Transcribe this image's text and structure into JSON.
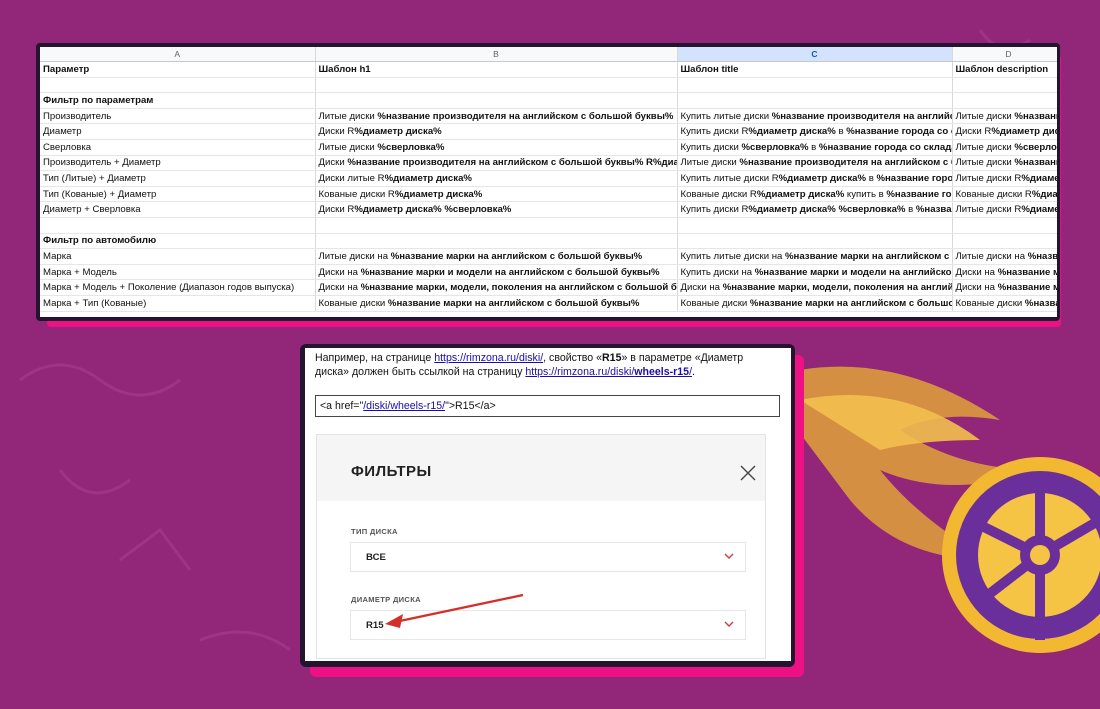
{
  "colors": {
    "background": "#92277a",
    "accent": "#ee1186",
    "frame": "#241430",
    "selected_column": "#d3e3fd",
    "link": "#1a0dab",
    "arrow": "#d4302a"
  },
  "sheet": {
    "columns": [
      "A",
      "B",
      "C",
      "D"
    ],
    "selected_column": "C",
    "header_row": [
      "Параметр",
      "Шаблон h1",
      "Шаблон title",
      "Шаблон description"
    ],
    "sections": [
      {
        "title": "Фильтр по параметрам",
        "rows": [
          {
            "a": "Производитель",
            "b": [
              [
                "Литые диски ",
                false
              ],
              [
                "%название производителя на английском с большой буквы%",
                true
              ]
            ],
            "c": [
              [
                "Купить литые диски ",
                false
              ],
              [
                "%название производителя на английском с большой буквы%",
                true
              ]
            ],
            "d": [
              [
                "Литые диски ",
                false
              ],
              [
                "%название производителя",
                true
              ]
            ]
          },
          {
            "a": "Диаметр",
            "b": [
              [
                "Диски R",
                false
              ],
              [
                "%диаметр диска%",
                true
              ]
            ],
            "c": [
              [
                "Купить диски R",
                false
              ],
              [
                "%диаметр диска%",
                true
              ],
              [
                " в ",
                false
              ],
              [
                "%название города со склада%",
                true
              ]
            ],
            "d": [
              [
                "Диски R",
                false
              ],
              [
                "%диаметр диска%",
                true
              ]
            ]
          },
          {
            "a": "Сверловка",
            "b": [
              [
                "Литые диски ",
                false
              ],
              [
                "%сверловка%",
                true
              ]
            ],
            "c": [
              [
                "Купить диски ",
                false
              ],
              [
                "%сверловка%",
                true
              ],
              [
                " в ",
                false
              ],
              [
                "%название города со склада%",
                true
              ]
            ],
            "d": [
              [
                "Литые диски ",
                false
              ],
              [
                "%сверловка%",
                true
              ]
            ]
          },
          {
            "a": "Производитель + Диаметр",
            "b": [
              [
                "Диски ",
                false
              ],
              [
                "%название производителя на английском с большой буквы% R%диаметр диска%",
                true
              ]
            ],
            "c": [
              [
                "Литые диски ",
                false
              ],
              [
                "%название производителя на английском с большой буквы%",
                true
              ]
            ],
            "d": [
              [
                "Литые диски ",
                false
              ],
              [
                "%название производителя",
                true
              ]
            ]
          },
          {
            "a": "Тип (Литые) + Диаметр",
            "b": [
              [
                "Диски литые R",
                false
              ],
              [
                "%диаметр диска%",
                true
              ]
            ],
            "c": [
              [
                "Купить литые диски R",
                false
              ],
              [
                "%диаметр диска%",
                true
              ],
              [
                " в ",
                false
              ],
              [
                "%название города со склада%",
                true
              ]
            ],
            "d": [
              [
                "Литые диски R",
                false
              ],
              [
                "%диаметр диска%",
                true
              ]
            ]
          },
          {
            "a": "Тип (Кованые) + Диаметр",
            "b": [
              [
                "Кованые диски R",
                false
              ],
              [
                "%диаметр диска%",
                true
              ]
            ],
            "c": [
              [
                "Кованые диски R",
                false
              ],
              [
                "%диаметр диска%",
                true
              ],
              [
                " купить в ",
                false
              ],
              [
                "%название города со склада%",
                true
              ]
            ],
            "d": [
              [
                "Кованые диски R",
                false
              ],
              [
                "%диаметр диска%",
                true
              ]
            ]
          },
          {
            "a": "Диаметр + Сверловка",
            "b": [
              [
                "Диски R",
                false
              ],
              [
                "%диаметр диска% %сверловка%",
                true
              ]
            ],
            "c": [
              [
                "Купить диски R",
                false
              ],
              [
                "%диаметр диска% %сверловка%",
                true
              ],
              [
                " в ",
                false
              ],
              [
                "%название города со склада%",
                true
              ]
            ],
            "d": [
              [
                "Литые диски R",
                false
              ],
              [
                "%диаметр диска%",
                true
              ]
            ]
          }
        ]
      },
      {
        "title": "Фильтр по автомобилю",
        "rows": [
          {
            "a": "Марка",
            "b": [
              [
                "Литые диски на ",
                false
              ],
              [
                "%название марки на английском с большой буквы%",
                true
              ]
            ],
            "c": [
              [
                "Купить литые диски на ",
                false
              ],
              [
                "%название марки на английском с большой буквы%",
                true
              ]
            ],
            "d": [
              [
                "Литые диски на ",
                false
              ],
              [
                "%название марки",
                true
              ]
            ]
          },
          {
            "a": "Марка + Модель",
            "b": [
              [
                "Диски на ",
                false
              ],
              [
                "%название марки и модели на английском с большой буквы%",
                true
              ]
            ],
            "c": [
              [
                "Купить диски на ",
                false
              ],
              [
                "%название марки и модели на английском с большой буквы%",
                true
              ]
            ],
            "d": [
              [
                "Диски на ",
                false
              ],
              [
                "%название марки",
                true
              ]
            ]
          },
          {
            "a": "Марка + Модель + Поколение (Диапазон годов выпуска)",
            "b": [
              [
                "Диски на ",
                false
              ],
              [
                "%название марки, модели, поколения на английском с большой буквы%",
                true
              ]
            ],
            "c": [
              [
                "Диски на ",
                false
              ],
              [
                "%название марки, модели, поколения на английском с большой буквы%",
                true
              ]
            ],
            "d": [
              [
                "Диски на ",
                false
              ],
              [
                "%название марки",
                true
              ]
            ]
          },
          {
            "a": "Марка + Тип (Кованые)",
            "b": [
              [
                "Кованые диски ",
                false
              ],
              [
                "%название марки на английском с большой буквы%",
                true
              ]
            ],
            "c": [
              [
                "Кованые диски ",
                false
              ],
              [
                "%название марки на английском с большой буквы%",
                true
              ]
            ],
            "d": [
              [
                "Кованые диски ",
                false
              ],
              [
                "%название марки",
                true
              ]
            ]
          }
        ]
      }
    ]
  },
  "note": {
    "prefix": "Например, на странице ",
    "link1": "https://rimzona.ru/diski/",
    "mid1": ", свойство «",
    "bold": "R15",
    "mid2": "» в параметре «Диаметр диска» должен быть ссылкой на страницу ",
    "link2_plain": "https://rimzona.ru/diski/",
    "link2_bold": "wheels-r15",
    "link2_tail": "/",
    "suffix": "."
  },
  "code": {
    "open": "<a href=\"",
    "href": "/diski/wheels-r15/",
    "close": "\">R15</a>"
  },
  "filters": {
    "title": "ФИЛЬТРЫ",
    "fields": [
      {
        "label": "ТИП ДИСКА",
        "value": "ВСЕ",
        "icon": "chevron-down-icon"
      },
      {
        "label": "ДИАМЕТР ДИСКА",
        "value": "R15",
        "icon": "chevron-down-icon"
      }
    ],
    "close_icon": "close-icon"
  }
}
